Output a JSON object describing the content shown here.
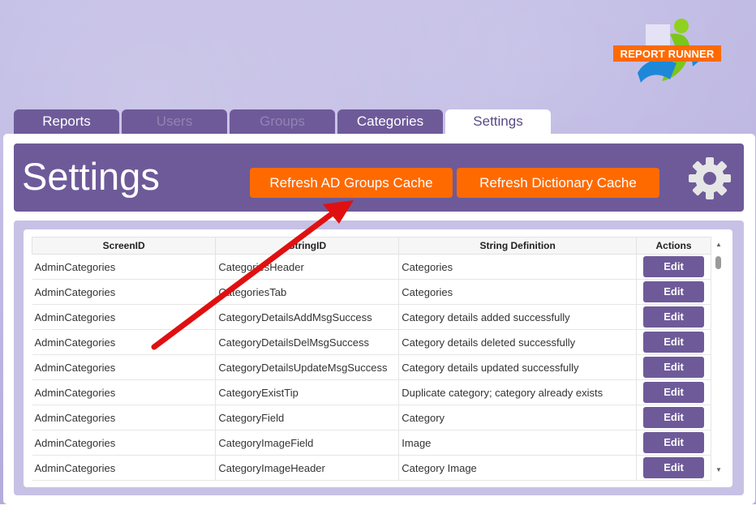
{
  "brand": {
    "logo_text": "REPORT RUNNER"
  },
  "tabs": [
    {
      "label": "Reports"
    },
    {
      "label": "Users"
    },
    {
      "label": "Groups"
    },
    {
      "label": "Categories"
    },
    {
      "label": "Settings"
    }
  ],
  "header": {
    "title": "Settings",
    "refresh_ad_label": "Refresh AD Groups Cache",
    "refresh_dict_label": "Refresh Dictionary Cache"
  },
  "table": {
    "columns": [
      "ScreenID",
      "StringID",
      "String Definition",
      "Actions"
    ],
    "edit_label": "Edit",
    "rows": [
      {
        "screen": "AdminCategories",
        "string_id": "CategoriesHeader",
        "definition": "Categories"
      },
      {
        "screen": "AdminCategories",
        "string_id": "CategoriesTab",
        "definition": "Categories"
      },
      {
        "screen": "AdminCategories",
        "string_id": "CategoryDetailsAddMsgSuccess",
        "definition": "Category details added successfully"
      },
      {
        "screen": "AdminCategories",
        "string_id": "CategoryDetailsDelMsgSuccess",
        "definition": "Category details deleted successfully"
      },
      {
        "screen": "AdminCategories",
        "string_id": "CategoryDetailsUpdateMsgSuccess",
        "definition": "Category details updated successfully"
      },
      {
        "screen": "AdminCategories",
        "string_id": "CategoryExistTip",
        "definition": "Duplicate category; category already exists"
      },
      {
        "screen": "AdminCategories",
        "string_id": "CategoryField",
        "definition": "Category"
      },
      {
        "screen": "AdminCategories",
        "string_id": "CategoryImageField",
        "definition": "Image"
      },
      {
        "screen": "AdminCategories",
        "string_id": "CategoryImageHeader",
        "definition": "Category Image"
      }
    ]
  },
  "colors": {
    "accent": "#6e5a99",
    "button": "#ff6a00",
    "arrow": "#e01010"
  }
}
